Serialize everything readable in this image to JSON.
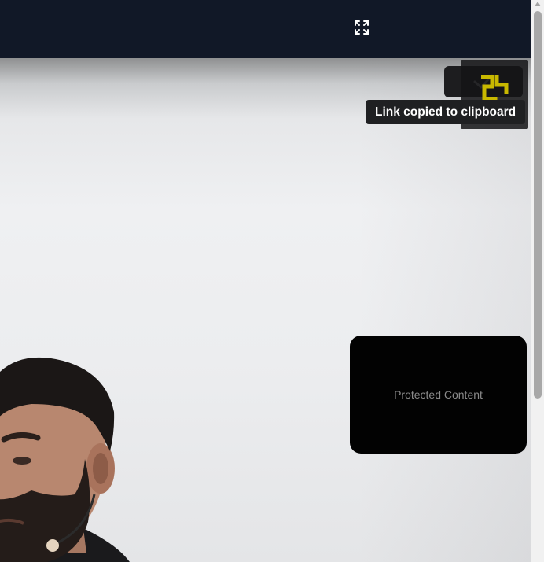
{
  "header": {
    "expand_icon": "expand-icon"
  },
  "overlay": {
    "check_icon": "checkmark-icon",
    "toast_text": "Link copied to clipboard"
  },
  "protected_panel": {
    "label": "Protected Content"
  },
  "colors": {
    "topbar": "#111827",
    "toast_bg": "#1f2022",
    "panel_bg": "#020202",
    "panel_text": "#8a8a8a"
  }
}
